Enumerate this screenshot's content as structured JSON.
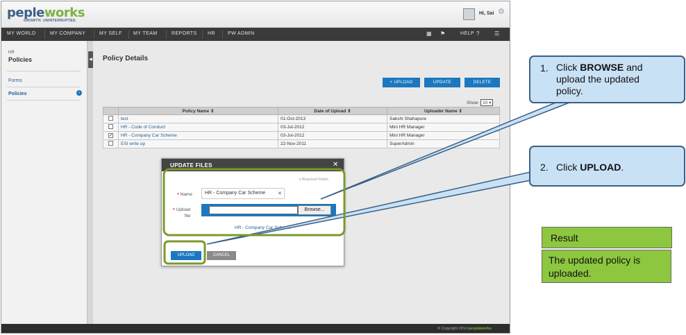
{
  "header": {
    "logo_a": "peple",
    "logo_b": "works",
    "tagline": "GROWTH. UNINTERRUPTED.",
    "greeting": "Hi, Sai"
  },
  "nav": {
    "items": [
      "MY WORLD",
      "MY COMPANY",
      "MY SELF",
      "MY TEAM",
      "REPORTS",
      "HR",
      "PW ADMIN"
    ],
    "help": "HELP"
  },
  "sidebar": {
    "section_small": "HR",
    "section_title": "Policies",
    "items": [
      "Forms",
      "Policies"
    ]
  },
  "main": {
    "title": "Policy Details",
    "buttons": {
      "upload": "+ UPLOAD",
      "update": "UPDATE",
      "delete": "DELETE"
    },
    "show_label": "Show:",
    "show_value": "10",
    "columns": [
      "Policy Name",
      "Date of Upload",
      "Uploader Name"
    ],
    "rows": [
      {
        "name": "test",
        "date": "01-Oct-2013",
        "uploader": "Sakshi Shahapure",
        "checked": false
      },
      {
        "name": "HR - Code of Conduct",
        "date": "03-Jul-2012",
        "uploader": "Mini HR Manager",
        "checked": false
      },
      {
        "name": "HR - Company Car Scheme",
        "date": "03-Jul-2012",
        "uploader": "Mini HR Manager",
        "checked": true
      },
      {
        "name": "ESI write up",
        "date": "22-Nov-2011",
        "uploader": "SuperAdmin",
        "checked": false
      }
    ]
  },
  "dialog": {
    "title": "UPDATE FILES",
    "required": "Required Fields",
    "name_label": "Name",
    "name_value": "HR - Company Car Scheme",
    "upload_label_1": "Upload",
    "upload_label_2": "file",
    "browse": "Browse...",
    "file_link": "HR - Company Car Scheme",
    "upload_btn": "UPLOAD",
    "cancel_btn": "CANCEL"
  },
  "footer": {
    "copyright": "© Copyright 2014",
    "brand": "peopleworks"
  },
  "callouts": {
    "step1_num": "1.",
    "step1_a": "Click ",
    "step1_b": "BROWSE",
    "step1_c": " and",
    "step1_d": "upload the updated",
    "step1_e": "policy.",
    "step2_num": "2.",
    "step2_a": "Click ",
    "step2_b": "UPLOAD",
    "step2_c": "."
  },
  "result": {
    "title": "Result",
    "line1": "The updated  policy is",
    "line2": "uploaded."
  },
  "colors": {
    "accent": "#1b78c0",
    "callout_bg": "#c9e1f5",
    "highlight": "#7b9a2a",
    "result_bg": "#8dc63f"
  }
}
